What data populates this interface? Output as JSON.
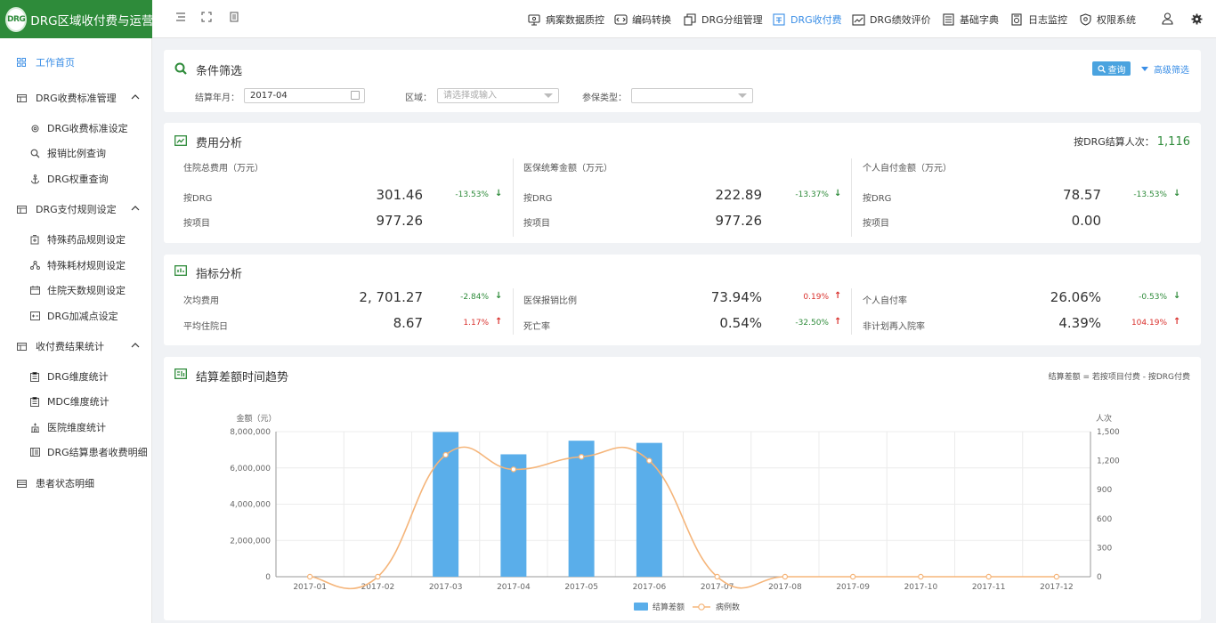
{
  "app": {
    "logo_text": "DRG",
    "title": "DRG区域收付费与运营"
  },
  "topnav": {
    "items": [
      {
        "label": "病案数据质控",
        "icon": "monitor-icon"
      },
      {
        "label": "编码转换",
        "icon": "code-icon"
      },
      {
        "label": "DRG分组管理",
        "icon": "copy-icon"
      },
      {
        "label": "DRG收付费",
        "icon": "payment-icon",
        "active": true
      },
      {
        "label": "DRG绩效评价",
        "icon": "trend-icon"
      },
      {
        "label": "基础字典",
        "icon": "book-icon"
      },
      {
        "label": "日志监控",
        "icon": "log-icon"
      },
      {
        "label": "权限系统",
        "icon": "shield-icon"
      }
    ]
  },
  "sidebar": {
    "home": "工作首页",
    "groups": [
      {
        "label": "DRG收费标准管理",
        "items": [
          "DRG收费标准设定",
          "报销比例查询",
          "DRG权重查询"
        ]
      },
      {
        "label": "DRG支付规则设定",
        "items": [
          "特殊药品规则设定",
          "特殊耗材规则设定",
          "住院天数规则设定",
          "DRG加减点设定"
        ]
      },
      {
        "label": "收付费结果统计",
        "items": [
          "DRG维度统计",
          "MDC维度统计",
          "医院维度统计",
          "DRG结算患者收费明细"
        ]
      }
    ],
    "last": "患者状态明细"
  },
  "filter": {
    "title": "条件筛选",
    "settle_month_label": "结算年月：",
    "settle_month_value": "2017-04",
    "region_label": "区域：",
    "region_placeholder": "请选择或输入",
    "insurance_label": "参保类型：",
    "insurance_value": "",
    "query_label": "查询",
    "advanced_label": "高级筛选"
  },
  "cost": {
    "title": "费用分析",
    "count_label": "按DRG结算人次：",
    "count_value": "1,116",
    "columns": [
      {
        "header": "住院总费用（万元）",
        "drg_label": "按DRG",
        "drg_value": "301.46",
        "drg_pct": "-13.53%",
        "dir": "down",
        "item_label": "按项目",
        "item_value": "977.26"
      },
      {
        "header": "医保统筹金额（万元）",
        "drg_label": "按DRG",
        "drg_value": "222.89",
        "drg_pct": "-13.37%",
        "dir": "down",
        "item_label": "按项目",
        "item_value": "977.26"
      },
      {
        "header": "个人自付金额（万元）",
        "drg_label": "按DRG",
        "drg_value": "78.57",
        "drg_pct": "-13.53%",
        "dir": "down",
        "item_label": "按项目",
        "item_value": "0.00"
      }
    ]
  },
  "index": {
    "title": "指标分析",
    "rows": [
      [
        {
          "label": "次均费用",
          "value": "2, 701.27",
          "pct": "-2.84%",
          "dir": "down"
        },
        {
          "label": "医保报销比例",
          "value": "73.94%",
          "pct": "0.19%",
          "dir": "up"
        },
        {
          "label": "个人自付率",
          "value": "26.06%",
          "pct": "-0.53%",
          "dir": "down"
        }
      ],
      [
        {
          "label": "平均住院日",
          "value": "8.67",
          "pct": "1.17%",
          "dir": "up"
        },
        {
          "label": "死亡率",
          "value": "0.54%",
          "pct": "-32.50%",
          "dir": "down"
        },
        {
          "label": "非计划再入院率",
          "value": "4.39%",
          "pct": "104.19%",
          "dir": "up"
        }
      ]
    ]
  },
  "trend": {
    "title": "结算差额时间趋势",
    "note": "结算差额 = 若按项目付费 - 按DRG付费"
  },
  "chart_data": {
    "type": "bar",
    "categories": [
      "2017-01",
      "2017-02",
      "2017-03",
      "2017-04",
      "2017-05",
      "2017-06",
      "2017-07",
      "2017-08",
      "2017-09",
      "2017-10",
      "2017-11",
      "2017-12"
    ],
    "series": [
      {
        "name": "结算差额",
        "type": "bar",
        "axis": "left",
        "color": "#5aaeea",
        "values": [
          0,
          0,
          7980000,
          6750000,
          7500000,
          7380000,
          0,
          0,
          0,
          0,
          0,
          0
        ]
      },
      {
        "name": "病例数",
        "type": "line",
        "axis": "right",
        "color": "#f5b57a",
        "values": [
          0,
          0,
          1260,
          1110,
          1240,
          1200,
          0,
          0,
          0,
          0,
          0,
          0
        ]
      }
    ],
    "ylabel_left": "金额（元）",
    "ylabel_right": "人次",
    "ylim_left": [
      0,
      8000000
    ],
    "ylim_right": [
      0,
      1500
    ],
    "yticks_left": [
      "0",
      "2,000,000",
      "4,000,000",
      "6,000,000",
      "8,000,000"
    ],
    "yticks_right": [
      "0",
      "300",
      "600",
      "900",
      "1,200",
      "1,500"
    ],
    "grid": true,
    "legend": "bottom-center"
  }
}
